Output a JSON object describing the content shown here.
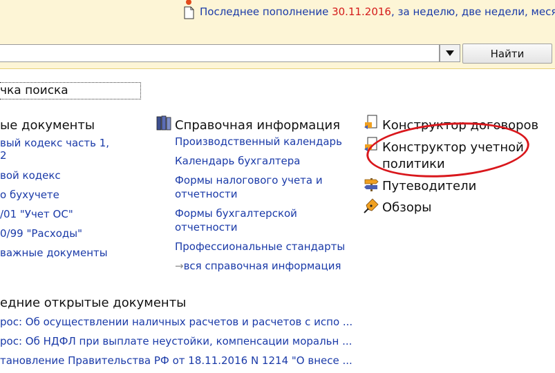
{
  "header": {
    "last_update_label": "Последнее пополнение",
    "last_update_date": "30.11.2016",
    "last_update_rest": ", за неделю, две недели, месяц"
  },
  "search": {
    "query": "",
    "find_label": "Найти"
  },
  "search_card_label": "чка поиска",
  "col1": {
    "title": "ые документы",
    "items": [
      "вый кодекс часть 1,",
      "2",
      "вой кодекс",
      "о бухучете",
      "/01 \"Учет ОС\"",
      "0/99 \"Расходы\"",
      "важные документы"
    ]
  },
  "col2": {
    "title": "Справочная информация",
    "items": [
      "Производственный календарь",
      "Календарь бухгалтера",
      "Формы налогового учета и",
      "отчетности",
      "Формы бухгалтерской",
      "отчетности",
      "Профессиональные стандарты"
    ],
    "all_label": "вся справочная информация"
  },
  "col3": {
    "items": [
      "Конструктор договоров",
      "Конструктор учетной",
      "политики",
      "Путеводители",
      "Обзоры"
    ]
  },
  "recent": {
    "title": "едние открытые документы",
    "items": [
      "рос: Об осуществлении наличных расчетов и расчетов с испо ...",
      "рос: Об НДФЛ при выплате неустойки, компенсации моральн ...",
      "тановление Правительства РФ от 18.11.2016 N 1214 \"О внесе  ..."
    ]
  },
  "colors": {
    "link": "#1a3aa8",
    "date": "#d41a1a",
    "topbar": "#fdf5d6",
    "annotation": "#d9171c"
  }
}
